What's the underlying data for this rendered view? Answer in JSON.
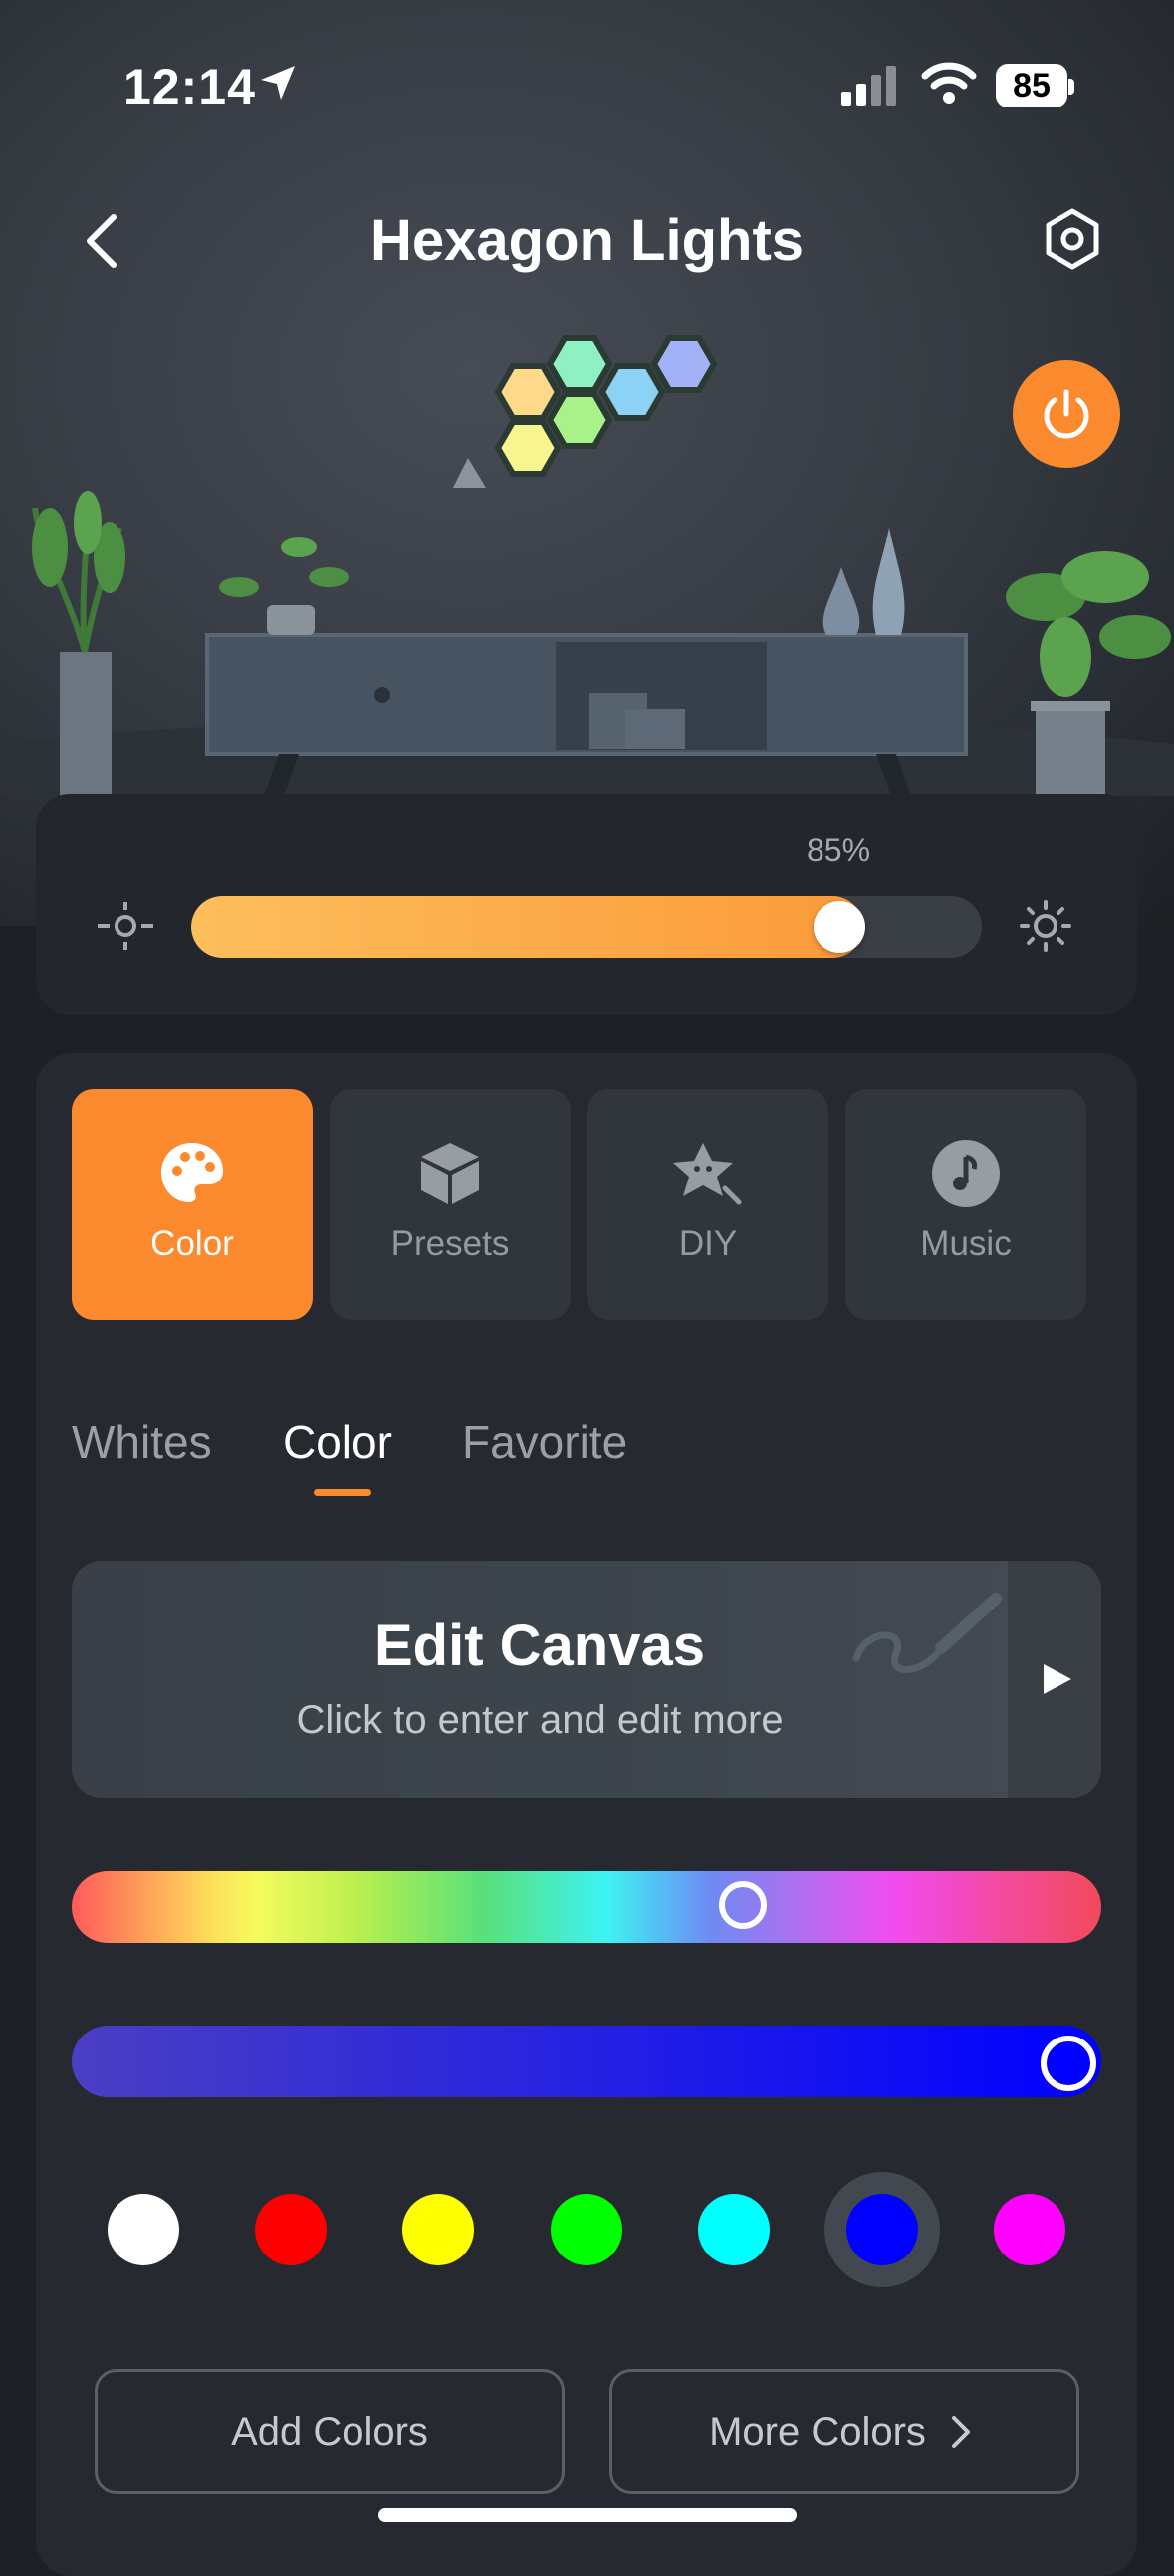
{
  "status_bar": {
    "time": "12:14",
    "battery": "85"
  },
  "header": {
    "title": "Hexagon Lights"
  },
  "brightness": {
    "value_label": "85%",
    "percent": 85
  },
  "mode_tabs": [
    {
      "label": "Color",
      "icon": "palette-icon",
      "active": true
    },
    {
      "label": "Presets",
      "icon": "cube-icon",
      "active": false
    },
    {
      "label": "DIY",
      "icon": "star-icon",
      "active": false
    },
    {
      "label": "Music",
      "icon": "music-note-icon",
      "active": false
    }
  ],
  "sub_tabs": [
    {
      "label": "Whites",
      "active": false
    },
    {
      "label": "Color",
      "active": true
    },
    {
      "label": "Favorite",
      "active": false
    }
  ],
  "edit_canvas": {
    "title": "Edit Canvas",
    "subtitle": "Click to enter and edit more"
  },
  "color_picker": {
    "hue_position": 0.65,
    "saturation_position": 1.0
  },
  "swatches": [
    "#ffffff",
    "#ff0000",
    "#ffff00",
    "#00ff00",
    "#00ffff",
    "#0000ff",
    "#ff00ff"
  ],
  "selected_swatch": 5,
  "buttons": {
    "add_colors": "Add Colors",
    "more_colors": "More Colors"
  },
  "accent_color": "#fb8a2e"
}
